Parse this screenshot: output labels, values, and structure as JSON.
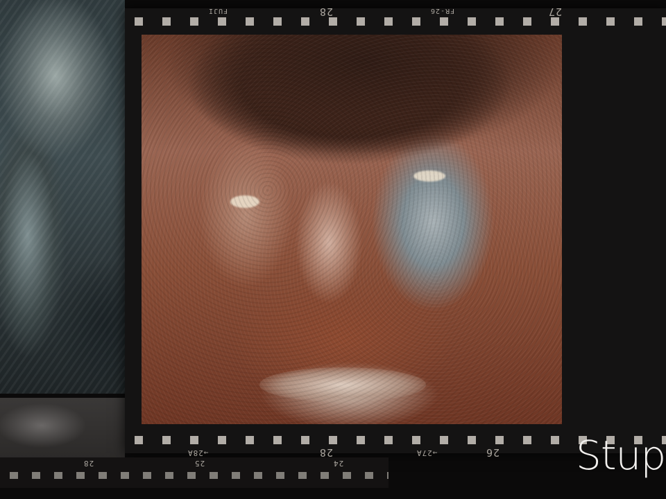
{
  "film_edge": {
    "top_frame_a": "28",
    "top_frame_b": "27",
    "top_code_a": "FUJI",
    "top_code_b": "FR-26",
    "bottom_frame_a": "28",
    "bottom_frame_b": "26",
    "bottom_code_a": "→28A",
    "bottom_code_b": "→27A"
  },
  "lower_strip": {
    "frame_a": "28",
    "frame_b": "25",
    "frame_c": "24"
  },
  "caption": "Stupe",
  "colors": {
    "film_base": "#141313",
    "caption": "#f2f0ee"
  }
}
